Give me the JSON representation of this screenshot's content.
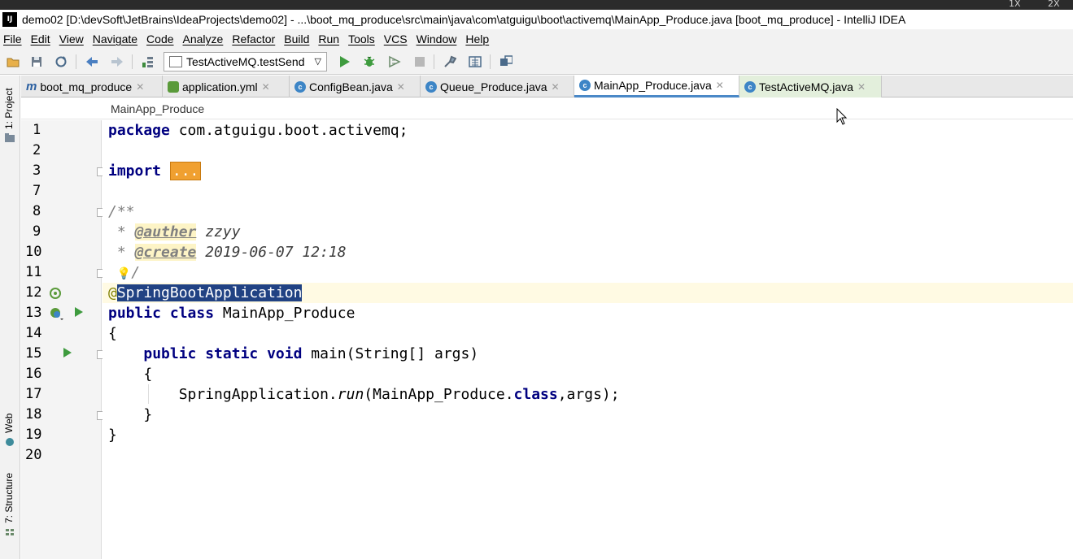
{
  "window": {
    "title": "demo02 [D:\\devSoft\\JetBrains\\IdeaProjects\\demo02] - ...\\boot_mq_produce\\src\\main\\java\\com\\atguigu\\boot\\activemq\\MainApp_Produce.java [boot_mq_produce] - IntelliJ IDEA",
    "app_icon": "IJ",
    "os_controls": [
      "1X",
      "2X"
    ]
  },
  "menu": [
    "File",
    "Edit",
    "View",
    "Navigate",
    "Code",
    "Analyze",
    "Refactor",
    "Build",
    "Run",
    "Tools",
    "VCS",
    "Window",
    "Help"
  ],
  "toolbar": {
    "run_config": "TestActiveMQ.testSend",
    "icons": [
      "open-folder-icon",
      "save-icon",
      "sync-icon",
      "back-icon",
      "forward-icon",
      "build-icon",
      "run-icon",
      "debug-icon",
      "coverage-icon",
      "stop-icon",
      "project-structure-icon",
      "sdk-icon",
      "layout-icon"
    ]
  },
  "side_tabs": {
    "project": "1: Project",
    "web": "Web",
    "structure": "7: Structure"
  },
  "tabs": [
    {
      "label": "boot_mq_produce",
      "icon": "m"
    },
    {
      "label": "application.yml",
      "icon": "yml"
    },
    {
      "label": "ConfigBean.java",
      "icon": "c"
    },
    {
      "label": "Queue_Produce.java",
      "icon": "c"
    },
    {
      "label": "MainApp_Produce.java",
      "icon": "c",
      "active": true
    },
    {
      "label": "TestActiveMQ.java",
      "icon": "c"
    }
  ],
  "breadcrumb": "MainApp_Produce",
  "code": {
    "line_numbers": [
      "1",
      "2",
      "3",
      "7",
      "8",
      "9",
      "10",
      "11",
      "12",
      "13",
      "14",
      "15",
      "16",
      "17",
      "18",
      "19",
      "20"
    ],
    "package_kw": "package",
    "package_name": " com.atguigu.boot.activemq;",
    "import_kw": "import",
    "import_folded": "...",
    "doc_open": "/**",
    "doc_star": " * ",
    "author_tag": "@auther",
    "author_val": " zzyy",
    "create_tag": "@create",
    "create_val": " 2019-06-07 12:18",
    "doc_close": "/",
    "annotation_at": "@",
    "annotation_name": "SpringBootApplication",
    "class_kw": "public class",
    "class_name": " MainApp_Produce",
    "brace_open": "{",
    "main_kw": "public static void",
    "main_sig": " main(String[] args)",
    "inner_open": "{",
    "run_obj": "SpringApplication.",
    "run_method": "run",
    "run_arg1": "(MainApp_Produce.",
    "run_class_kw": "class",
    "run_arg2": ",args);",
    "inner_close": "}",
    "brace_close": "}"
  }
}
